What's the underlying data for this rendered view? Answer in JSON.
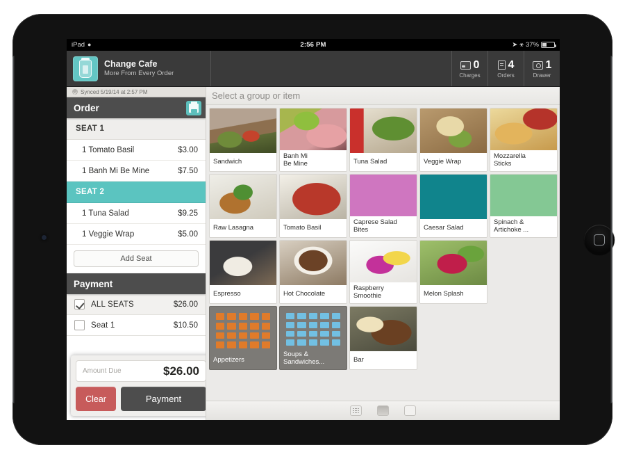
{
  "status_bar": {
    "device_label": "iPad",
    "wifi_icon": "wifi-icon",
    "time": "2:56 PM",
    "location_icon": "location-arrow-icon",
    "bluetooth_icon": "bluetooth-icon",
    "battery_percent": "37%"
  },
  "app_bar": {
    "logo_icon": "jar-logo-icon",
    "brand_name": "Change Cafe",
    "brand_tagline": "More From Every Order",
    "counters": [
      {
        "icon": "credit-card-icon",
        "value": "0",
        "label": "Charges"
      },
      {
        "icon": "receipt-icon",
        "value": "4",
        "label": "Orders"
      },
      {
        "icon": "cash-drawer-icon",
        "value": "1",
        "label": "Drawer"
      }
    ]
  },
  "order_panel": {
    "synced_icon": "sync-check-icon",
    "synced_text": "Synced 5/19/14 at 2:57 PM",
    "header_title": "Order",
    "print_icon": "printer-icon",
    "seats": [
      {
        "label": "SEAT 1",
        "active": false,
        "items": [
          {
            "qty_name": "1 Tomato Basil",
            "price": "$3.00"
          },
          {
            "qty_name": "1 Banh Mi Be Mine",
            "price": "$7.50"
          }
        ]
      },
      {
        "label": "SEAT 2",
        "active": true,
        "items": [
          {
            "qty_name": "1 Tuna Salad",
            "price": "$9.25"
          },
          {
            "qty_name": "1 Veggie Wrap",
            "price": "$5.00"
          }
        ]
      }
    ],
    "add_seat_label": "Add Seat",
    "payment_header": "Payment",
    "payment_rows": [
      {
        "label": "ALL SEATS",
        "amount": "$26.00",
        "checked": true
      },
      {
        "label": "Seat 1",
        "amount": "$10.50",
        "checked": false
      }
    ],
    "amount_due_placeholder": "Amount Due",
    "amount_due_value": "$26.00",
    "clear_label": "Clear",
    "payment_label": "Payment"
  },
  "grid_panel": {
    "title": "Select a group or item",
    "rows": [
      [
        {
          "name": "Sandwich",
          "kind": "photo",
          "art": "ph-sandwich"
        },
        {
          "name": "Banh Mi\nBe Mine",
          "kind": "photo",
          "art": "ph-banhmi",
          "two_line": true
        },
        {
          "name": "Tuna Salad",
          "kind": "photo",
          "art": "ph-tuna"
        },
        {
          "name": "Veggie Wrap",
          "kind": "photo",
          "art": "ph-wrap"
        },
        {
          "name": "Mozzarella\nSticks",
          "kind": "photo",
          "art": "ph-mozz",
          "two_line": true
        }
      ],
      [
        {
          "name": "Raw Lasagna",
          "kind": "photo",
          "art": "ph-lasagna"
        },
        {
          "name": "Tomato Basil",
          "kind": "photo",
          "art": "ph-tomato"
        },
        {
          "name": "Caprese Salad\nBites",
          "kind": "color",
          "color": "#cf76c0",
          "two_line": true
        },
        {
          "name": "Caesar Salad",
          "kind": "color",
          "color": "#10848c"
        },
        {
          "name": "Spinach &\nArtichoke ...",
          "kind": "color",
          "color": "#84c894",
          "two_line": true
        }
      ],
      [
        {
          "name": "Espresso",
          "kind": "photo",
          "art": "ph-espresso"
        },
        {
          "name": "Hot Chocolate",
          "kind": "photo",
          "art": "ph-cocoa"
        },
        {
          "name": "Raspberry\nSmoothie",
          "kind": "photo",
          "art": "ph-rasp",
          "two_line": true
        },
        {
          "name": "Melon Splash",
          "kind": "photo",
          "art": "ph-melon"
        }
      ],
      [
        {
          "name": "Appetizers",
          "kind": "group",
          "dot_color": "#e07b2a"
        },
        {
          "name": "Soups &\nSandwiches...",
          "kind": "group",
          "dot_color": "#72c0e3",
          "two_line": true
        },
        {
          "name": "Bar",
          "kind": "photo",
          "art": "ph-bar"
        }
      ]
    ],
    "view_buttons": [
      {
        "icon": "grid-view-icon",
        "state": "grid"
      },
      {
        "icon": "large-view-icon",
        "state": "selected"
      },
      {
        "icon": "list-view-icon",
        "state": "empty"
      }
    ]
  },
  "colors": {
    "accent_teal": "#5bc4c0",
    "danger_red": "#c75b5b",
    "dark_chrome": "#3a3a3a"
  }
}
